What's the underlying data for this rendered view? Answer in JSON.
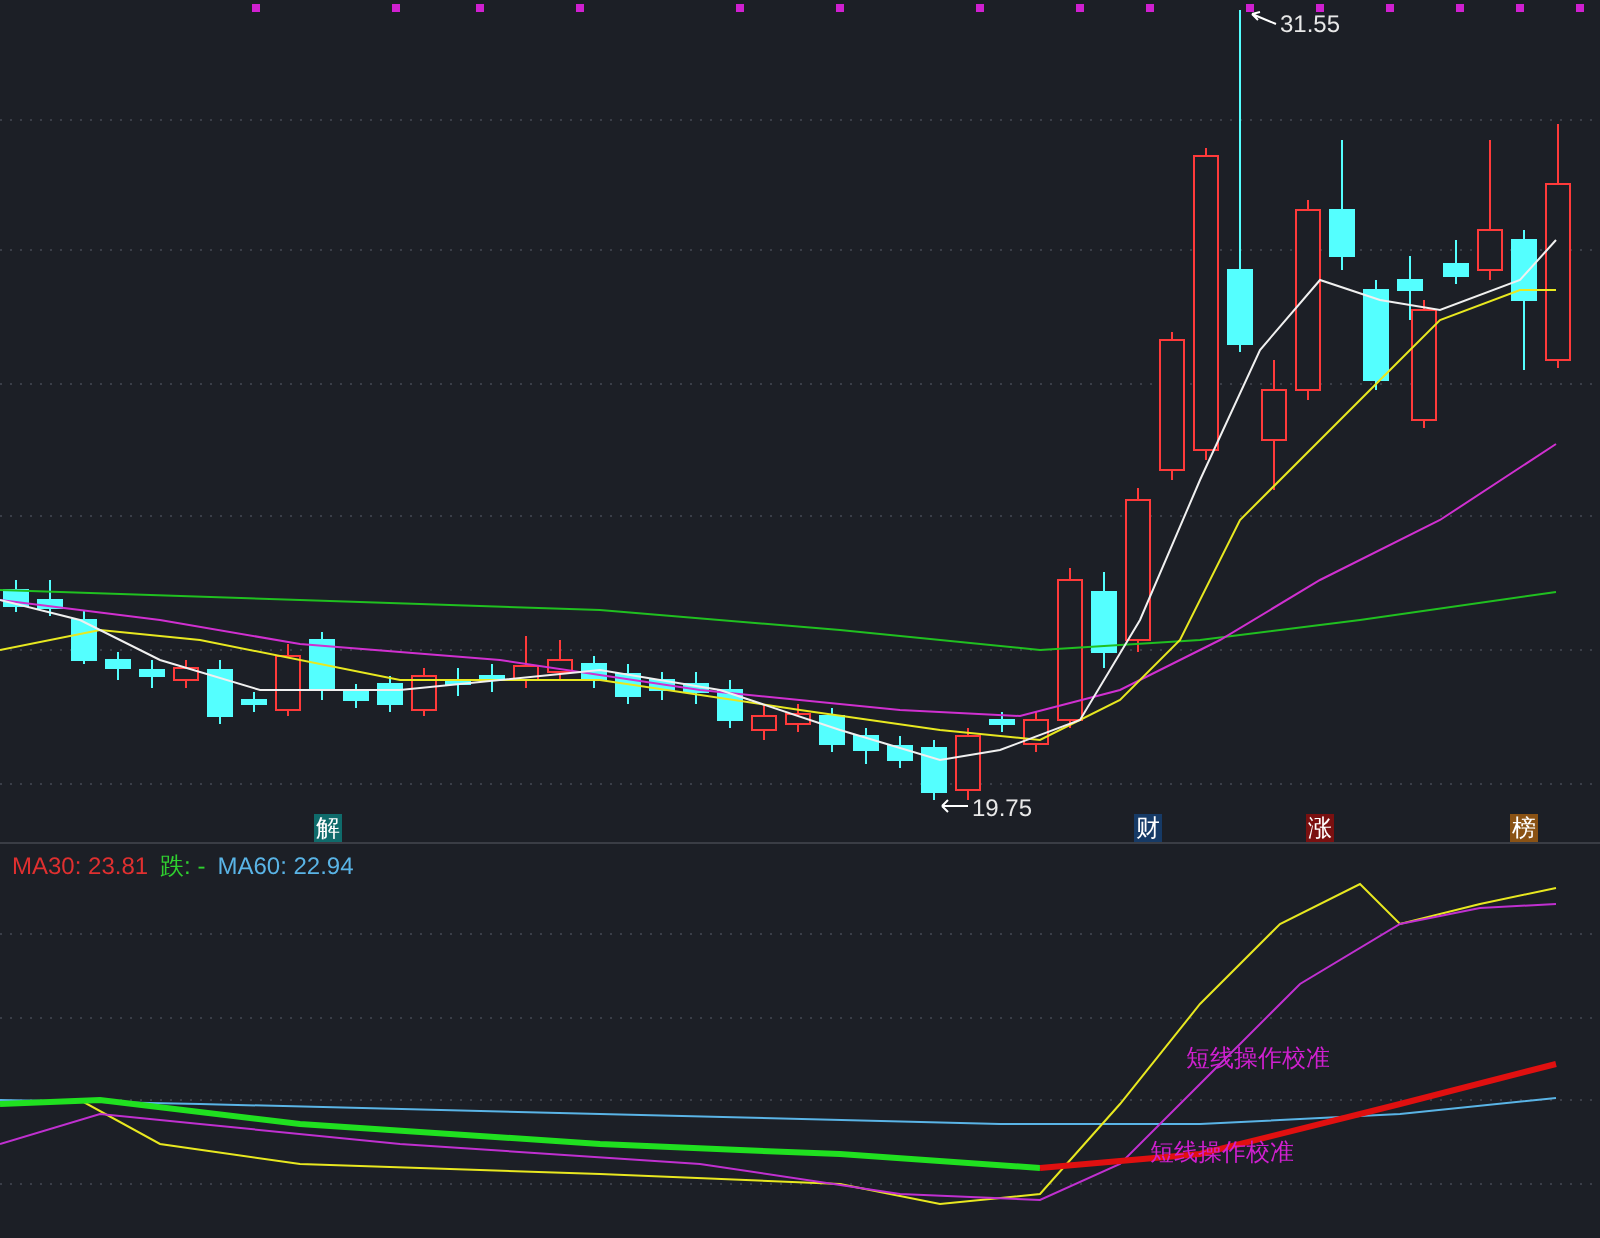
{
  "price_chart": {
    "high_label": "31.55",
    "low_label": "19.75",
    "event_tags": [
      {
        "text": "解",
        "color": "#0f6b6b"
      },
      {
        "text": "财",
        "color": "#163a66"
      },
      {
        "text": "涨",
        "color": "#7a1010"
      },
      {
        "text": "榜",
        "color": "#8a5214"
      }
    ]
  },
  "indicator_panel": {
    "legend": [
      {
        "text": "MA30: 23.81",
        "color": "#e03030"
      },
      {
        "text": "跌: -",
        "color": "#2fd02f"
      },
      {
        "text": "MA60: 22.94",
        "color": "#5ab4e6"
      }
    ],
    "signal_labels": [
      "短线操作校准",
      "短线操作校准"
    ]
  }
}
